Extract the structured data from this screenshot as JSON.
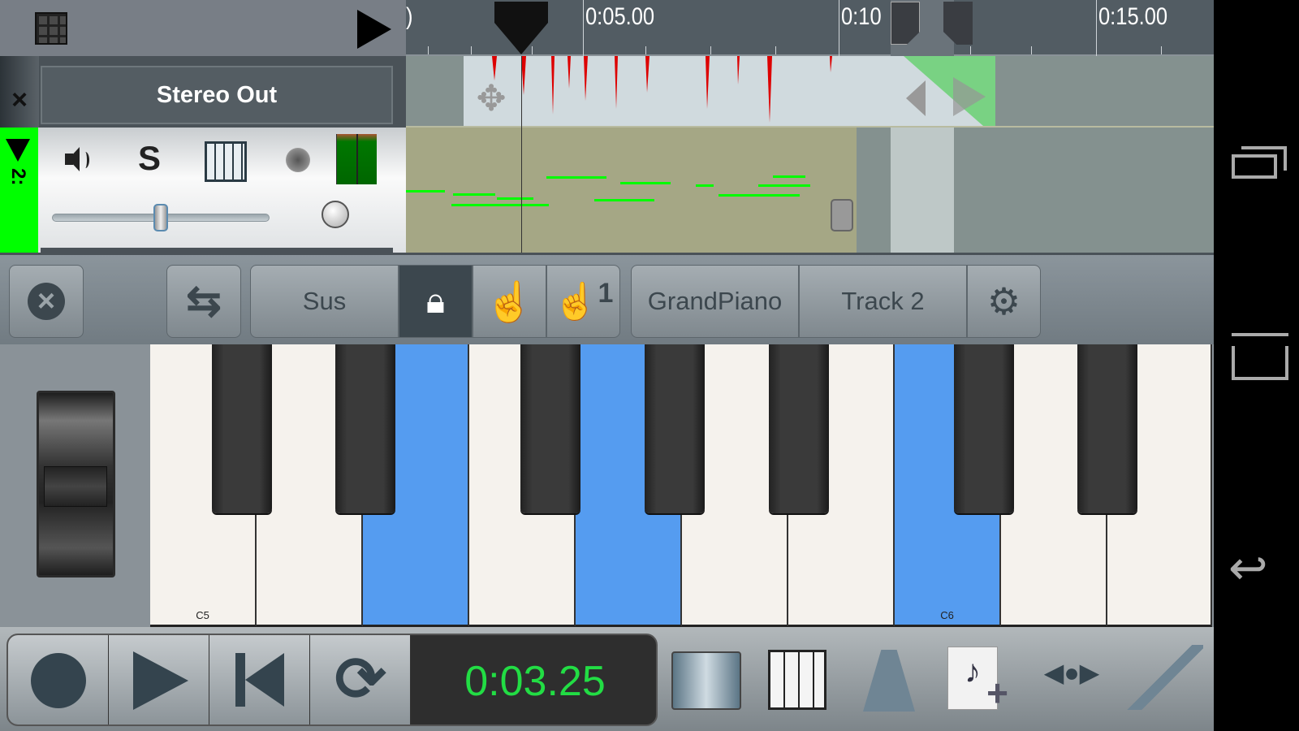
{
  "header": {
    "grid_icon": "grid-icon",
    "play_icon": "play-icon"
  },
  "ruler": {
    "labels": [
      "0:05.00",
      "0:10",
      "0:15.00"
    ],
    "partial_label": ")"
  },
  "tracks": [
    {
      "name": "Stereo Out",
      "close_label": "×"
    },
    {
      "number": "2:",
      "controls": [
        "speaker-icon",
        "solo",
        "piano-icon",
        "record-arm",
        "level-meter"
      ],
      "solo_label": "S",
      "volume": 0.5
    }
  ],
  "toolbar": {
    "sus_label": "Sus",
    "instrument_label": "GrandPiano",
    "track_label": "Track 2",
    "hand_one_label": "1"
  },
  "keyboard": {
    "labels": {
      "c5": "C5",
      "c6": "C6"
    },
    "pressed_keys": [
      "E5",
      "G5",
      "C6"
    ],
    "highlight_color": "#559cf0"
  },
  "transport": {
    "time": "0:03.25",
    "time_color": "#22dd44"
  },
  "colors": {
    "track_active": "#00ff00",
    "midi_note": "#00ff00",
    "audio_peak": "#dd0000"
  }
}
